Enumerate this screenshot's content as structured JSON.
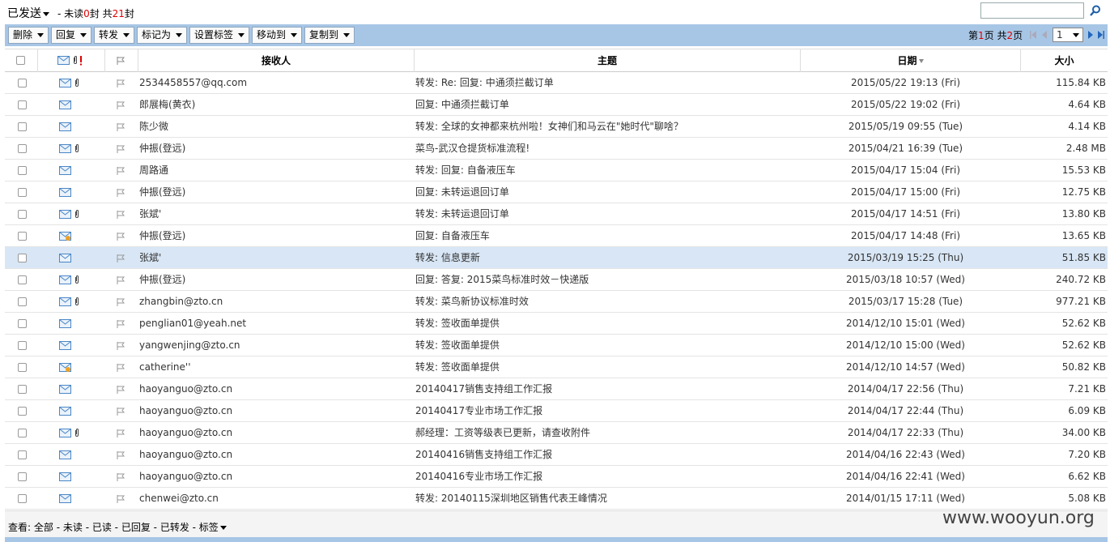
{
  "header": {
    "folder_title": "已发送",
    "unread_prefix": "- 未读",
    "unread_count": "0",
    "unread_unit": "封 共",
    "total_count": "21",
    "total_unit": "封",
    "search_placeholder": ""
  },
  "toolbar": {
    "buttons": [
      "删除",
      "回复",
      "转发",
      "标记为",
      "设置标签",
      "移动到",
      "复制到"
    ],
    "pager_prefix": "第",
    "pager_current": "1",
    "pager_mid": "页 共",
    "pager_total": "2",
    "pager_suffix": "页",
    "page_select_value": "1"
  },
  "columns": {
    "recipient": "接收人",
    "subject": "主题",
    "date": "日期",
    "size": "大小"
  },
  "rows": [
    {
      "recipient": "2534458557@qq.com",
      "subject": "转发: Re: 回复: 中通须拦截订单",
      "date": "2015/05/22 19:13 (Fri)",
      "size": "115.84 KB",
      "attach": true,
      "icon": "envelope-icon"
    },
    {
      "recipient": "郎展梅(黄衣)",
      "subject": "回复: 中通须拦截订单",
      "date": "2015/05/22 19:02 (Fri)",
      "size": "4.64 KB",
      "attach": false,
      "icon": "envelope-icon"
    },
    {
      "recipient": "陈少微",
      "subject": "转发: 全球的女神都来杭州啦！女神们和马云在\"她时代\"聊啥？",
      "date": "2015/05/19 09:55 (Tue)",
      "size": "4.14 KB",
      "attach": false,
      "icon": "envelope-icon"
    },
    {
      "recipient": "仲振(登远)",
      "subject": "菜鸟-武汉仓提货标准流程!",
      "date": "2015/04/21 16:39 (Tue)",
      "size": "2.48 MB",
      "attach": true,
      "icon": "envelope-icon"
    },
    {
      "recipient": "周路通",
      "subject": "转发: 回复: 自备液压车",
      "date": "2015/04/17 15:04 (Fri)",
      "size": "15.53 KB",
      "attach": false,
      "icon": "envelope-icon"
    },
    {
      "recipient": "仲振(登远)",
      "subject": "回复: 未转运退回订单",
      "date": "2015/04/17 15:00 (Fri)",
      "size": "12.75 KB",
      "attach": false,
      "icon": "envelope-icon"
    },
    {
      "recipient": "张斌'",
      "subject": "转发: 未转运退回订单",
      "date": "2015/04/17 14:51 (Fri)",
      "size": "13.80 KB",
      "attach": true,
      "icon": "envelope-icon"
    },
    {
      "recipient": "仲振(登远)",
      "subject": "回复: 自备液压车",
      "date": "2015/04/17 14:48 (Fri)",
      "size": "13.65 KB",
      "attach": false,
      "icon": "envelope-replied-icon"
    },
    {
      "recipient": "张斌'",
      "subject": "转发: 信息更新",
      "date": "2015/03/19 15:25 (Thu)",
      "size": "51.85 KB",
      "attach": false,
      "icon": "envelope-icon",
      "selected": true
    },
    {
      "recipient": "仲振(登远)",
      "subject": "回复: 答复: 2015菜鸟标准时效－快递版",
      "date": "2015/03/18 10:57 (Wed)",
      "size": "240.72 KB",
      "attach": true,
      "icon": "envelope-icon"
    },
    {
      "recipient": "zhangbin@zto.cn",
      "subject": "转发: 菜鸟新协议标准时效",
      "date": "2015/03/17 15:28 (Tue)",
      "size": "977.21 KB",
      "attach": true,
      "icon": "envelope-icon"
    },
    {
      "recipient": "penglian01@yeah.net",
      "subject": "转发: 签收面单提供",
      "date": "2014/12/10 15:01 (Wed)",
      "size": "52.62 KB",
      "attach": false,
      "icon": "envelope-icon"
    },
    {
      "recipient": "yangwenjing@zto.cn",
      "subject": "转发: 签收面单提供",
      "date": "2014/12/10 15:00 (Wed)",
      "size": "52.62 KB",
      "attach": false,
      "icon": "envelope-icon"
    },
    {
      "recipient": "catherine''",
      "subject": "转发: 签收面单提供",
      "date": "2014/12/10 14:57 (Wed)",
      "size": "50.82 KB",
      "attach": false,
      "icon": "envelope-replied-icon"
    },
    {
      "recipient": "haoyanguo@zto.cn",
      "subject": "20140417销售支持组工作汇报",
      "date": "2014/04/17 22:56 (Thu)",
      "size": "7.21 KB",
      "attach": false,
      "icon": "envelope-icon"
    },
    {
      "recipient": "haoyanguo@zto.cn",
      "subject": "20140417专业市场工作汇报",
      "date": "2014/04/17 22:44 (Thu)",
      "size": "6.09 KB",
      "attach": false,
      "icon": "envelope-icon"
    },
    {
      "recipient": "haoyanguo@zto.cn",
      "subject": "郝经理：工资等级表已更新，请查收附件",
      "date": "2014/04/17 22:33 (Thu)",
      "size": "34.00 KB",
      "attach": true,
      "icon": "envelope-icon"
    },
    {
      "recipient": "haoyanguo@zto.cn",
      "subject": "20140416销售支持组工作汇报",
      "date": "2014/04/16 22:43 (Wed)",
      "size": "7.20 KB",
      "attach": false,
      "icon": "envelope-icon"
    },
    {
      "recipient": "haoyanguo@zto.cn",
      "subject": "20140416专业市场工作汇报",
      "date": "2014/04/16 22:41 (Wed)",
      "size": "6.62 KB",
      "attach": false,
      "icon": "envelope-icon"
    },
    {
      "recipient": "chenwei@zto.cn",
      "subject": "转发: 20140115深圳地区销售代表王峰情况",
      "date": "2014/01/15 17:11 (Wed)",
      "size": "5.08 KB",
      "attach": false,
      "icon": "envelope-icon"
    }
  ],
  "footer": {
    "view_label": "查看:",
    "filters": [
      "全部",
      "未读",
      "已读",
      "已回复",
      "已转发",
      "标签"
    ]
  },
  "watermark": "www.wooyun.org"
}
